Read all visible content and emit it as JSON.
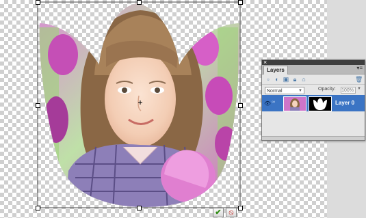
{
  "canvas": {
    "artwork": "tulip-cutout-photo-of-girl"
  },
  "commit": {
    "commit_icon": "check-icon",
    "cancel_icon": "cancel-icon",
    "commit_glyph": "✔",
    "cancel_glyph": "⦸"
  },
  "layers_panel": {
    "close_glyph": "×",
    "tab_label": "Layers",
    "menu_glyph": "▾≡",
    "blend_mode": "Normal",
    "opacity_label": "Opacity:",
    "opacity_value": "100%",
    "layers": [
      {
        "name": "Layer 0",
        "selected": true,
        "visible": true
      }
    ]
  },
  "colors": {
    "selection": "#3b74c4",
    "panel_bg": "#e6e6e6",
    "commit_green": "#2e8b12",
    "cancel_red": "#c0211b"
  }
}
